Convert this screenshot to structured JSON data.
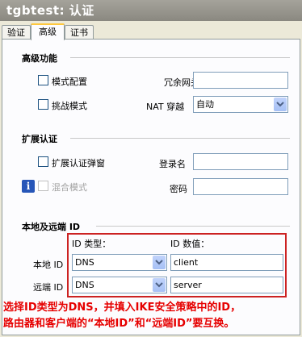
{
  "window": {
    "title": "tgbtest: 认证"
  },
  "tabs": [
    {
      "label": "验证",
      "active": false
    },
    {
      "label": "高级",
      "active": true
    },
    {
      "label": "证书",
      "active": false
    }
  ],
  "advanced": {
    "title": "高级功能",
    "mode_config_label": "模式配置",
    "mode_config_checked": false,
    "aggressive_mode_label": "挑战模式",
    "aggressive_mode_checked": false,
    "redundant_gateway_label": "冗余网关",
    "redundant_gateway_value": "",
    "nat_label": "NAT 穿越",
    "nat_value": "自动"
  },
  "extended_auth": {
    "title": "扩展认证",
    "popup_label": "扩展认证弹窗",
    "popup_checked": false,
    "hybrid_label": "混合模式",
    "hybrid_checked": false,
    "login_label": "登录名",
    "login_value": "",
    "password_label": "密码",
    "password_value": ""
  },
  "ids": {
    "title": "本地及远端 ID",
    "type_header": "ID 类型：",
    "value_header": "ID 数值：",
    "local_label": "本地 ID",
    "local_type": "DNS",
    "local_value": "client",
    "remote_label": "远端 ID",
    "remote_type": "DNS",
    "remote_value": "server"
  },
  "caption": {
    "line1": "选择ID类型为DNS，并填入IKE安全策略中的ID，",
    "line2": "路由器和客户端的“本地ID”和“远端ID”要互换。"
  },
  "colors": {
    "annotation_red": "#cc2222",
    "caption_red": "#e60000",
    "tab_highlight": "#ffc83c"
  }
}
